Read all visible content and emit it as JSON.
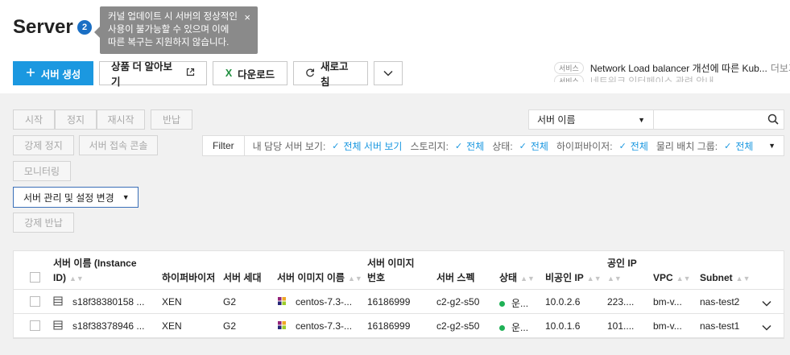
{
  "header": {
    "title": "Server",
    "badge": "2",
    "tooltip": "커널 업데이트 시 서버의 정상적인 사용이 불가능할 수 있으며 이에 따른 복구는 지원하지 않습니다.",
    "tooltip_close": "×"
  },
  "toolbar": {
    "create_label": "서버 생성",
    "learn_more_label": "상품 더 알아보기",
    "download_label": "다운로드",
    "refresh_label": "새로고침",
    "more_icon": "chevron-down-icon"
  },
  "notice": {
    "tag": "서비스",
    "text": "Network Load balancer 개선에 따른 Kub...",
    "more": "더보기",
    "next_text": "네트워크 인터페이스 관련 안내"
  },
  "actions": {
    "start": "시작",
    "stop": "정지",
    "restart": "재시작",
    "return": "반납",
    "force_stop": "강제 정지",
    "console": "서버 접속 콘솔",
    "monitoring": "모니터링",
    "manage": "서버 관리 및 설정 변경",
    "force_return": "강제 반납"
  },
  "search": {
    "field": "서버 이름",
    "value": ""
  },
  "filter": {
    "label": "Filter",
    "items": [
      {
        "key": "내 담당 서버 보기:",
        "value": "전체 서버 보기"
      },
      {
        "key": "스토리지:",
        "value": "전체"
      },
      {
        "key": "상태:",
        "value": "전체"
      },
      {
        "key": "하이퍼바이저:",
        "value": "전체"
      },
      {
        "key": "물리 배치 그룹:",
        "value": "전체"
      }
    ]
  },
  "table": {
    "columns": {
      "name_line1": "서버 이름 (Instance",
      "name_line2": "ID)",
      "hypervisor": "하이퍼바이저",
      "generation": "서버 세대",
      "image": "서버 이미지 이름",
      "image_no_line1": "서버 이미지",
      "image_no_line2": "번호",
      "spec": "서버 스펙",
      "status": "상태",
      "private_ip": "비공인 IP",
      "public_ip": "공인 IP",
      "vpc": "VPC",
      "subnet": "Subnet"
    },
    "rows": [
      {
        "name": "s18f38380158 ...",
        "hypervisor": "XEN",
        "generation": "G2",
        "image": "centos-7.3-...",
        "image_no": "16186999",
        "spec": "c2-g2-s50",
        "status": "운...",
        "private_ip": "10.0.2.6",
        "public_ip": "223....",
        "vpc": "bm-v...",
        "subnet": "nas-test2"
      },
      {
        "name": "s18f38378946 ...",
        "hypervisor": "XEN",
        "generation": "G2",
        "image": "centos-7.3-...",
        "image_no": "16186999",
        "spec": "c2-g2-s50",
        "status": "운...",
        "private_ip": "10.0.1.6",
        "public_ip": "101....",
        "vpc": "bm-v...",
        "subnet": "nas-test1"
      }
    ]
  },
  "colors": {
    "primary": "#1b98e0",
    "status_running": "#1fb156",
    "badge": "#1a6fc4",
    "excel": "#1e8e3e"
  }
}
